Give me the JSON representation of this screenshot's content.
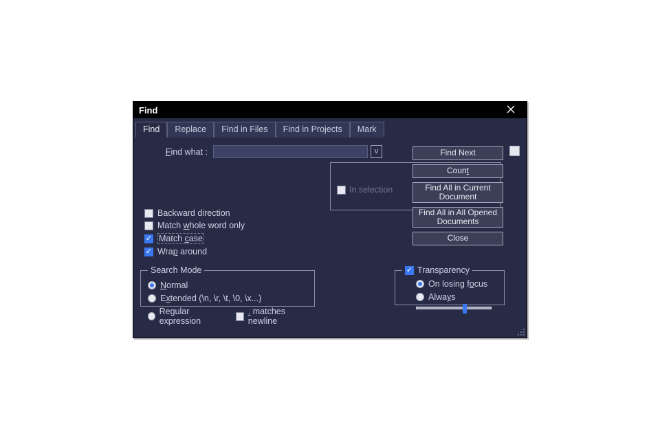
{
  "title": "Find",
  "tabs": [
    "Find",
    "Replace",
    "Find in Files",
    "Find in Projects",
    "Mark"
  ],
  "active_tab": 0,
  "find_label_prefix": "F",
  "find_label_rest": "ind what :",
  "find_value": "",
  "in_selection_label": "In selection",
  "in_selection_checked": false,
  "buttons": {
    "find_next": "Find Next",
    "count": "Count",
    "find_all_current": "Find All in Current Document",
    "find_all_opened": "Find All in All Opened Documents",
    "close": "Close"
  },
  "checks": {
    "backward": {
      "label_pref": "Backward direction",
      "checked": false
    },
    "whole": {
      "label_pref": "Match ",
      "under": "w",
      "label_suf": "hole word only",
      "checked": false
    },
    "case": {
      "label_pref": "Match ",
      "under": "c",
      "label_suf": "ase",
      "checked": true
    },
    "wrap": {
      "label_pref": "Wra",
      "under": "p",
      "label_suf": " around",
      "checked": true
    }
  },
  "search_mode": {
    "legend": "Search Mode",
    "options": [
      {
        "pref": "",
        "under": "N",
        "suf": "ormal",
        "checked": true
      },
      {
        "pref": "E",
        "under": "x",
        "suf": "tended (\\n, \\r, \\t, \\0, \\x...)",
        "checked": false
      },
      {
        "pref": "Re",
        "under": "g",
        "suf": "ular expression",
        "checked": false,
        "extra": {
          "pref": "",
          "under": ".",
          "suf": " matches newline",
          "checked": false
        }
      }
    ]
  },
  "transparency": {
    "legend": "Transparency",
    "enabled": true,
    "options": [
      {
        "pref": "On losing f",
        "under": "o",
        "suf": "cus",
        "checked": true
      },
      {
        "pref": "Alwa",
        "under": "y",
        "suf": "s",
        "checked": false
      }
    ],
    "slider_pct": 62
  }
}
